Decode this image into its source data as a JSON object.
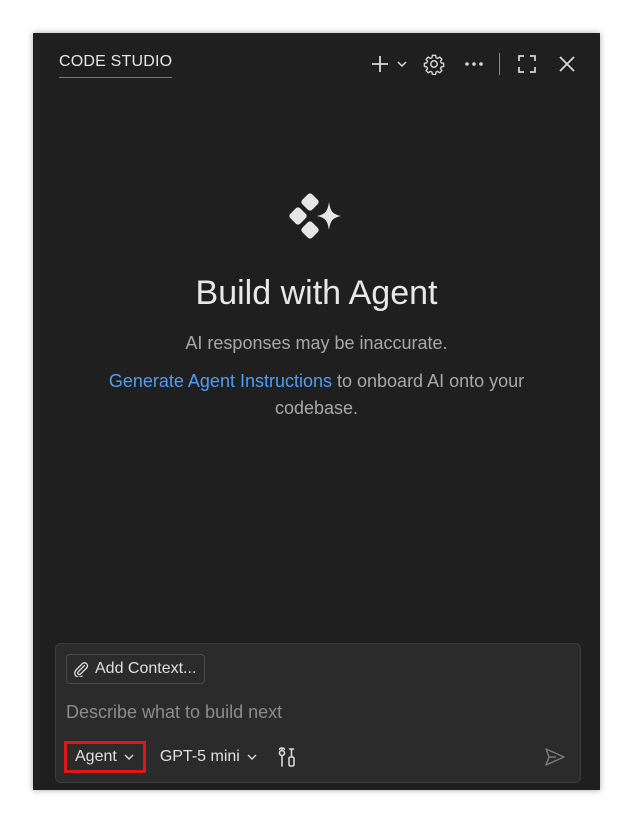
{
  "header": {
    "title": "CODE STUDIO",
    "icons": [
      "plus-icon",
      "chevron-down-icon",
      "gear-icon",
      "ellipsis-icon",
      "maximize-icon",
      "close-icon"
    ]
  },
  "hero": {
    "icon": "agent-sparkle-icon",
    "title": "Build with Agent",
    "disclaimer": "AI responses may be inaccurate.",
    "link_text": "Generate Agent Instructions",
    "onboard_text": " to onboard AI onto your codebase."
  },
  "input": {
    "add_context_label": "Add Context...",
    "placeholder": "Describe what to build next",
    "value": "",
    "mode_label": "Agent",
    "model_label": "GPT-5 mini",
    "tools_icon": "tools-icon",
    "send_icon": "send-icon"
  },
  "colors": {
    "panel_bg": "#1f1f1f",
    "input_bg": "#2b2b2b",
    "link": "#4f9df5",
    "highlight": "#e01616",
    "tab_underline": "#3b82f6"
  }
}
